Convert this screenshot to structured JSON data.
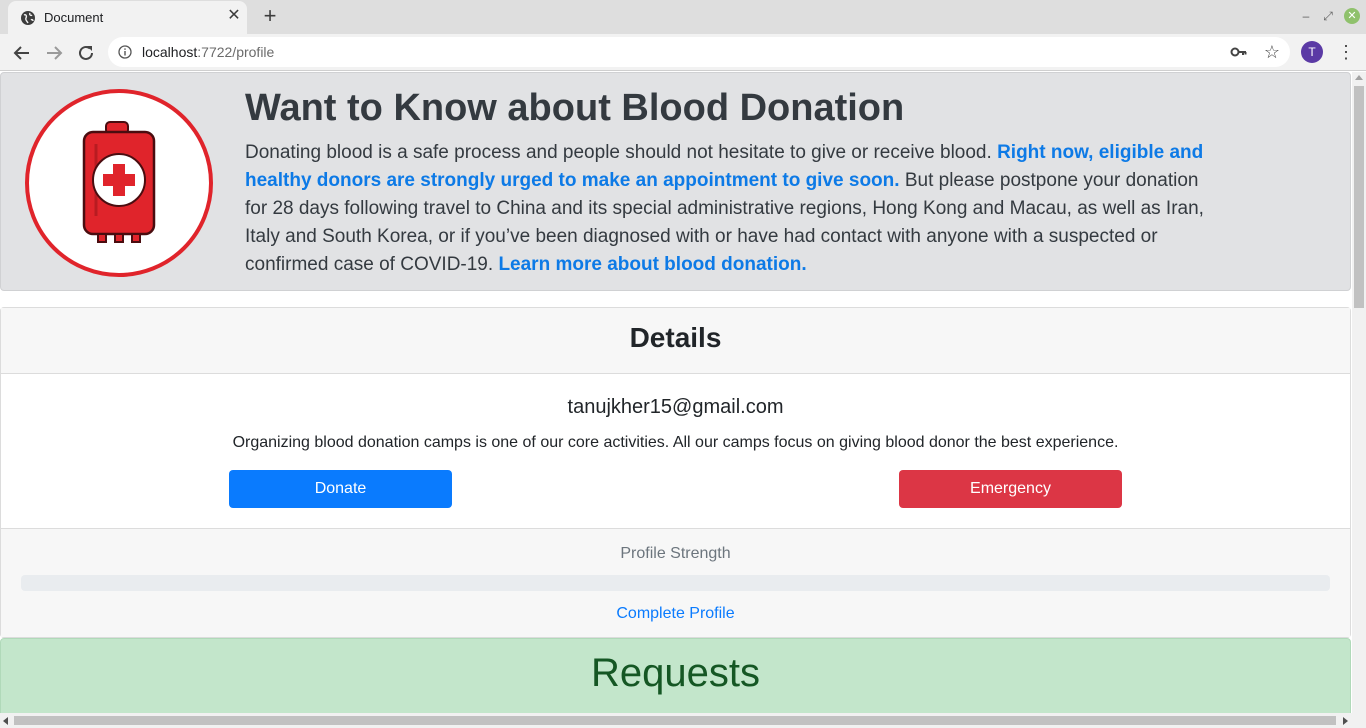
{
  "browser": {
    "tab_title": "Document",
    "new_tab": "+",
    "url_host": "localhost",
    "url_rest": ":7722/profile",
    "profile_initial": "T"
  },
  "hero": {
    "title": "Want to Know about Blood Donation",
    "text_1": "Donating blood is a safe process and people should not hesitate to give or receive blood.",
    "text_emphasis": "Right now, eligible and healthy donors are strongly urged to make an appointment to give soon.",
    "text_2": "But please postpone your donation for 28 days following travel to China and its special administrative regions, Hong Kong and Macau, as well as Iran, Italy and South Korea, or if you’ve been diagnosed with or have had contact with anyone with a suspected or confirmed case of COVID-19.",
    "learn_more": "Learn more about blood donation."
  },
  "details": {
    "title": "Details",
    "email": "tanujkher15@gmail.com",
    "description": "Organizing blood donation camps is one of our core activities. All our camps focus on giving blood donor the best experience.",
    "donate_label": "Donate",
    "emergency_label": "Emergency",
    "strength_label": "Profile Strength",
    "strength_percent": 0,
    "complete_profile_label": "Complete Profile"
  },
  "requests": {
    "title": "Requests"
  },
  "colors": {
    "primary": "#0a7bfe",
    "danger": "#dc3645",
    "success_bg": "#c3e6cb",
    "success_text": "#155724",
    "logo_red": "#e0242b"
  }
}
